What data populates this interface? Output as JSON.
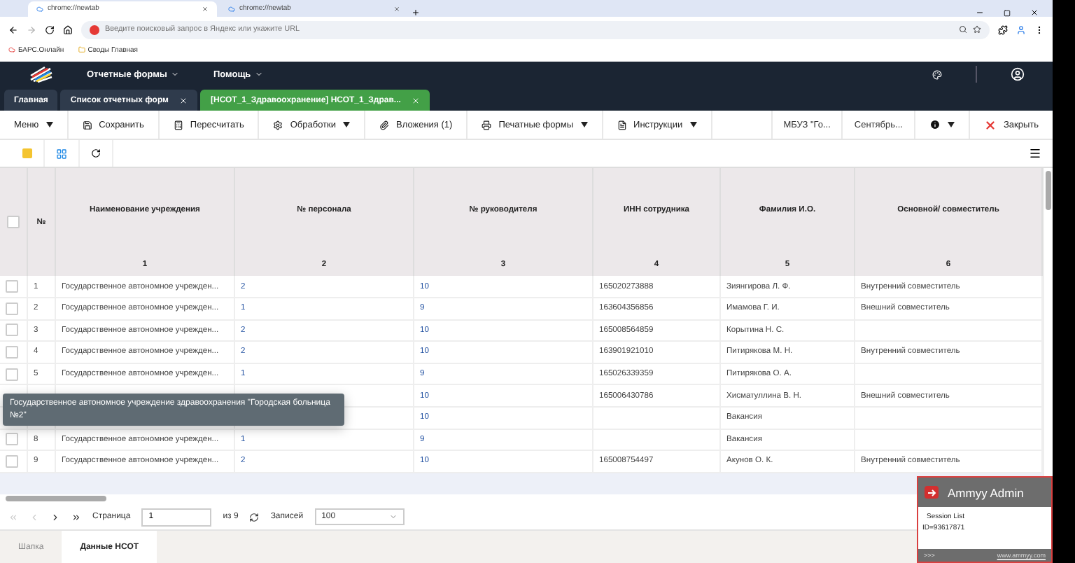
{
  "browser": {
    "tabs": [
      {
        "title": "chrome://newtab",
        "selected": true
      },
      {
        "title": "chrome://newtab",
        "selected": false
      }
    ],
    "address": {
      "placeholder": "Введите поисковый запрос в Яндекс или укажите URL"
    },
    "bookmarks": [
      "БАРС.Онлайн",
      "Своды Главная"
    ]
  },
  "header": {
    "menus": [
      "Отчетные формы",
      "Помощь"
    ]
  },
  "app_tabs": [
    {
      "label": "Главная",
      "closable": false,
      "selected": false
    },
    {
      "label": "Список отчетных форм",
      "closable": true,
      "selected": false
    },
    {
      "label": "[НСОТ_1_Здравоохранение] НСОТ_1_Здрав...",
      "closable": true,
      "selected": true
    }
  ],
  "toolbar": [
    {
      "kind": "menu",
      "label": "Меню",
      "dropdown": true
    },
    {
      "kind": "save",
      "label": "Сохранить",
      "dropdown": false
    },
    {
      "kind": "calc",
      "label": "Пересчитать",
      "dropdown": false
    },
    {
      "kind": "gear",
      "label": "Обработки",
      "dropdown": true
    },
    {
      "kind": "clip",
      "label": "Вложения (1)",
      "dropdown": false
    },
    {
      "kind": "print",
      "label": "Печатные формы",
      "dropdown": true
    },
    {
      "kind": "doc",
      "label": "Инструкции",
      "dropdown": true
    }
  ],
  "toolbar_right": {
    "org": "МБУЗ \"Го...",
    "period": "Сентябрь...",
    "info_dropdown": true,
    "close": "Закрыть"
  },
  "table": {
    "columns": [
      {
        "title": "Наименование учреждения",
        "number": "1"
      },
      {
        "title": "№ персонала",
        "number": "2"
      },
      {
        "title": "№ руководителя",
        "number": "3"
      },
      {
        "title": "ИНН сотрудника",
        "number": "4"
      },
      {
        "title": "Фамилия И.О.",
        "number": "5"
      },
      {
        "title": "Основной/ совместитель",
        "number": "6"
      }
    ],
    "num_header": "№",
    "all_checked": false,
    "rows": [
      {
        "num": "1",
        "checked": false,
        "cells": [
          "Государственное автономное учрежден...",
          "2",
          "10",
          "165020273888",
          "Зиянгирова Л. Ф.",
          "Внутренний совместитель"
        ]
      },
      {
        "num": "2",
        "checked": false,
        "cells": [
          "Государственное автономное учрежден...",
          "1",
          "9",
          "163604356856",
          "Имамова Г. И.",
          "Внешний совместитель"
        ]
      },
      {
        "num": "3",
        "checked": false,
        "cells": [
          "Государственное автономное учрежден...",
          "2",
          "10",
          "165008564859",
          "Корытина Н. С.",
          ""
        ]
      },
      {
        "num": "4",
        "checked": false,
        "cells": [
          "Государственное автономное учрежден...",
          "2",
          "10",
          "163901921010",
          "Питирякова М. Н.",
          "Внутренний совместитель"
        ]
      },
      {
        "num": "5",
        "checked": false,
        "cells": [
          "Государственное автономное учрежден...",
          "1",
          "9",
          "165026339359",
          "Питирякова О. А.",
          ""
        ]
      },
      {
        "num": "",
        "cells": [
          "",
          "",
          "10",
          "165006430786",
          "Хисматуллина В. Н.",
          "Внешний совместитель"
        ]
      },
      {
        "num": "",
        "cells": [
          "",
          "",
          "10",
          "",
          "Вакансия",
          ""
        ]
      },
      {
        "num": "8",
        "checked": false,
        "cells": [
          "Государственное автономное учрежден...",
          "1",
          "9",
          "",
          "Вакансия",
          ""
        ]
      },
      {
        "num": "9",
        "checked": false,
        "cells": [
          "Государственное автономное учрежден...",
          "2",
          "10",
          "165008754497",
          "Акунов О. К.",
          "Внутренний совместитель"
        ]
      }
    ],
    "tooltip": "Государственное автономное учреждение здравоохранения \"Городская больница №2\""
  },
  "pager": {
    "page_label": "Страница",
    "page": "1",
    "of": "из 9",
    "records_label": "Записей",
    "records": "100"
  },
  "bottom_tabs": [
    {
      "label": "Шапка",
      "selected": false
    },
    {
      "label": "Данные НСОТ",
      "selected": true
    }
  ],
  "overlay": {
    "title": "Ammyy Admin",
    "lines": [
      "Session List",
      "ID=93617871"
    ],
    "footer_left": ">>>",
    "footer_link": "www.ammyy.com"
  }
}
